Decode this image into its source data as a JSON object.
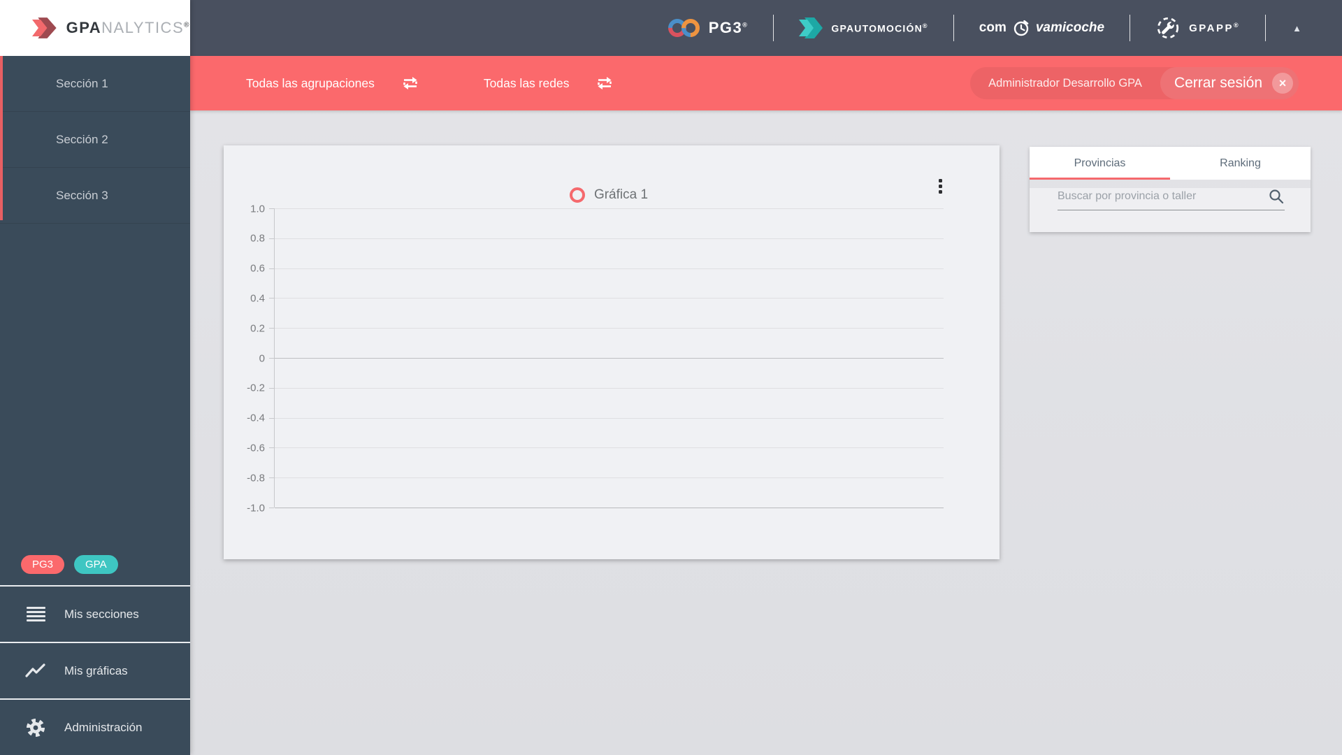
{
  "app": {
    "title_part_bold": "GPA",
    "title_part_light": "NALYTICS",
    "trademark": "®"
  },
  "sidebar": {
    "sections": [
      {
        "label": "Sección 1"
      },
      {
        "label": "Sección 2"
      },
      {
        "label": "Sección 3"
      }
    ],
    "badges": [
      {
        "label": "PG3"
      },
      {
        "label": "GPA"
      }
    ],
    "menu": [
      {
        "label": "Mis secciones"
      },
      {
        "label": "Mis gráficas"
      },
      {
        "label": "Administración"
      }
    ]
  },
  "header": {
    "brands": {
      "pg3": {
        "name": "PG3",
        "trademark": "®"
      },
      "automocion": {
        "name": "GPAUTOMOCIÓN",
        "trademark": "®"
      },
      "comprovamicoche": {
        "pre": "com",
        "post": "vamicoche"
      },
      "gpapp": {
        "name": "GPAPP",
        "trademark": "®"
      }
    }
  },
  "filter_bar": {
    "agrupaciones_label": "Todas las agrupaciones",
    "redes_label": "Todas las redes",
    "user_name": "Administrador Desarrollo GPA",
    "logout_label": "Cerrar sesión",
    "close_glyph": "×"
  },
  "chart_data": {
    "type": "line",
    "title": "Gráfica 1",
    "series": [
      {
        "name": "Gráfica 1",
        "values": []
      }
    ],
    "x": [],
    "ylim": [
      -1,
      1
    ],
    "yticks": [
      1,
      0.8,
      0.6,
      0.4,
      0.2,
      0,
      -0.2,
      -0.4,
      -0.6,
      -0.8,
      -1
    ],
    "grid": true,
    "legend_position": "top-center"
  },
  "side_panel": {
    "tabs": [
      {
        "label": "Provincias",
        "active": true
      },
      {
        "label": "Ranking",
        "active": false
      }
    ],
    "search_placeholder": "Buscar por provincia o taller"
  },
  "colors": {
    "accent_red": "#FB696C",
    "accent_teal": "#3EC6C2",
    "sidebar_bg": "#3A4B5A",
    "header_bg": "#49505F",
    "page_bg": "#E1E2E6",
    "card_bg": "#F0F1F4"
  }
}
